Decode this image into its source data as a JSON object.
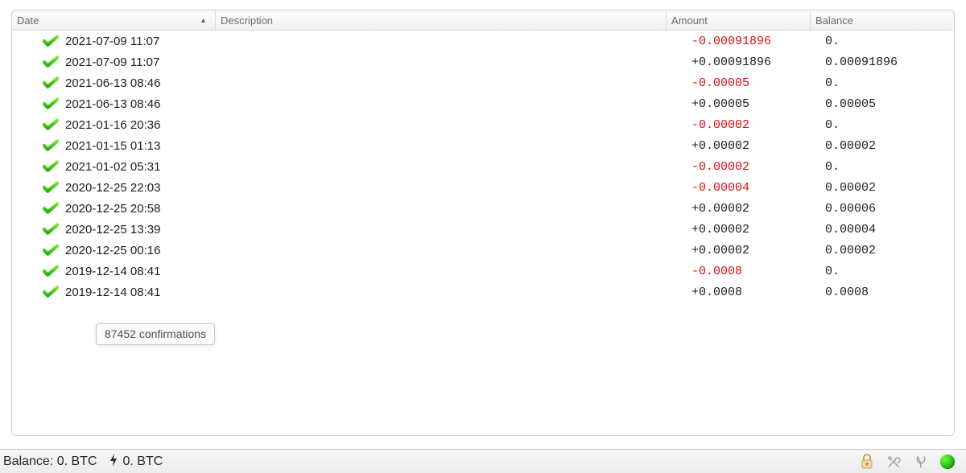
{
  "columns": {
    "date": "Date",
    "description": "Description",
    "amount": "Amount",
    "balance": "Balance",
    "sort_icon": "▲"
  },
  "rows": [
    {
      "date": "2021-07-09 11:07",
      "amount": "-0.00091896",
      "neg": true,
      "balance": "0."
    },
    {
      "date": "2021-07-09 11:07",
      "amount": "+0.00091896",
      "neg": false,
      "balance": "0.00091896"
    },
    {
      "date": "2021-06-13 08:46",
      "amount": "-0.00005",
      "neg": true,
      "balance": "0."
    },
    {
      "date": "2021-06-13 08:46",
      "amount": "+0.00005",
      "neg": false,
      "balance": "0.00005"
    },
    {
      "date": "2021-01-16 20:36",
      "amount": "-0.00002",
      "neg": true,
      "balance": "0."
    },
    {
      "date": "2021-01-15 01:13",
      "amount": "+0.00002",
      "neg": false,
      "balance": "0.00002"
    },
    {
      "date": "2021-01-02 05:31",
      "amount": "-0.00002",
      "neg": true,
      "balance": "0."
    },
    {
      "date": "2020-12-25 22:03",
      "amount": "-0.00004",
      "neg": true,
      "balance": "0.00002"
    },
    {
      "date": "2020-12-25 20:58",
      "amount": "+0.00002",
      "neg": false,
      "balance": "0.00006"
    },
    {
      "date": "2020-12-25 13:39",
      "amount": "+0.00002",
      "neg": false,
      "balance": "0.00004"
    },
    {
      "date": "2020-12-25 00:16",
      "amount": "+0.00002",
      "neg": false,
      "balance": "0.00002"
    },
    {
      "date": "2019-12-14 08:41",
      "amount": "-0.0008",
      "neg": true,
      "balance": "0."
    },
    {
      "date": "2019-12-14 08:41",
      "amount": "+0.0008",
      "neg": false,
      "balance": "0.0008"
    }
  ],
  "tooltip": "87452 confirmations",
  "status": {
    "balance_text": "Balance: 0. BTC",
    "lightning_text": "0. BTC"
  },
  "colors": {
    "negative": "#d40f12",
    "positive": "#1d1d1d",
    "header_text": "#6a6a6a",
    "status_green": "#1faa0e"
  }
}
